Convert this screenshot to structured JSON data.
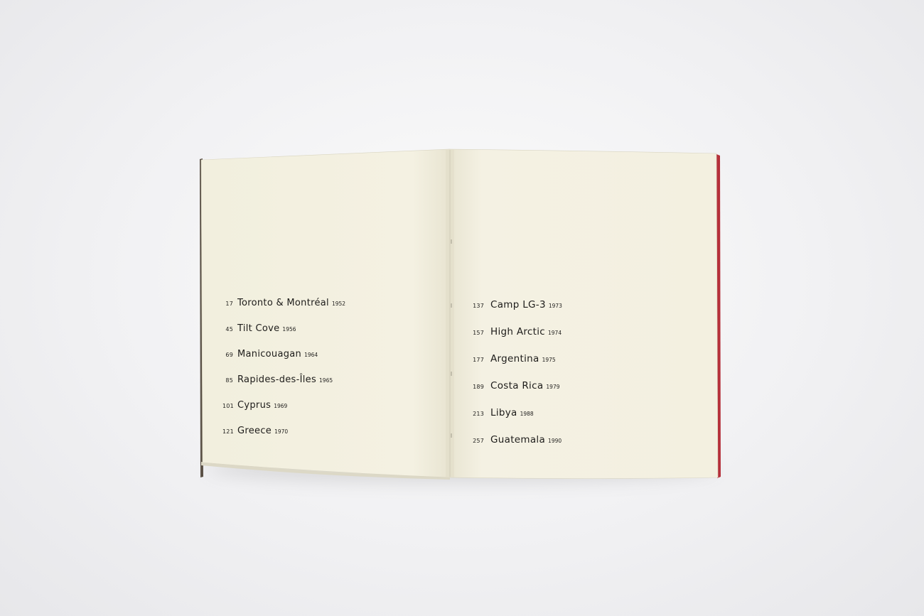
{
  "left_page": {
    "entries": [
      {
        "page": "17",
        "title": "Toronto & Montréal",
        "year": "1952"
      },
      {
        "page": "45",
        "title": "Tilt Cove",
        "year": "1956"
      },
      {
        "page": "69",
        "title": "Manicouagan",
        "year": "1964"
      },
      {
        "page": "85",
        "title": "Rapides-des-Îles",
        "year": "1965"
      },
      {
        "page": "101",
        "title": "Cyprus",
        "year": "1969"
      },
      {
        "page": "121",
        "title": "Greece",
        "year": "1970"
      }
    ]
  },
  "right_page": {
    "entries": [
      {
        "page": "137",
        "title": "Camp LG-3",
        "year": "1973"
      },
      {
        "page": "157",
        "title": "High Arctic",
        "year": "1974"
      },
      {
        "page": "177",
        "title": "Argentina",
        "year": "1975"
      },
      {
        "page": "189",
        "title": "Costa Rica",
        "year": "1979"
      },
      {
        "page": "213",
        "title": "Libya",
        "year": "1988"
      },
      {
        "page": "257",
        "title": "Guatemala",
        "year": "1990"
      }
    ]
  },
  "colors": {
    "background": "#f1f1f3",
    "paper": "#f3f0e1",
    "cover_edge": "#b5303a",
    "ink": "#1d1c1a"
  }
}
